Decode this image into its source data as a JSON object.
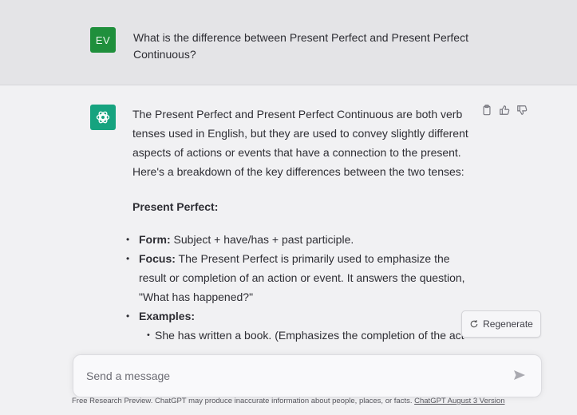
{
  "user_message": {
    "avatar_initials": "EV",
    "text": "What is the difference between Present Perfect and Present Perfect Continuous?"
  },
  "assistant_message": {
    "intro": "The Present Perfect and Present Perfect Continuous are both verb tenses used in English, but they are used to convey slightly different aspects of actions or events that have a connection to the present. Here's a breakdown of the key differences between the two tenses:",
    "section_heading": "Present Perfect:",
    "form_label": "Form:",
    "form_text": " Subject + have/has + past participle.",
    "focus_label": "Focus:",
    "focus_text": " The Present Perfect is primarily used to emphasize the result or completion of an action or event. It answers the question, \"What has happened?\"",
    "examples_label": "Examples:",
    "example_1": "She has written a book. (Emphasizes the completion of the act"
  },
  "actions": {
    "copy_icon": "clipboard-icon",
    "like_icon": "thumbs-up-icon",
    "dislike_icon": "thumbs-down-icon"
  },
  "regenerate": {
    "label": "Regenerate",
    "icon": "refresh-icon"
  },
  "composer": {
    "placeholder": "Send a message",
    "send_icon": "send-icon"
  },
  "footer": {
    "text": "Free Research Preview. ChatGPT may produce inaccurate information about people, places, or facts. ",
    "link": "ChatGPT August 3 Version"
  },
  "colors": {
    "user_avatar": "#1f8f3c",
    "bot_avatar": "#16a37f"
  }
}
